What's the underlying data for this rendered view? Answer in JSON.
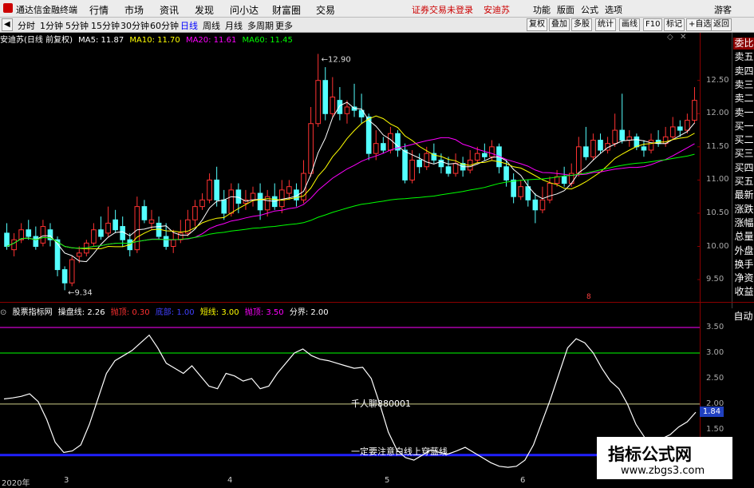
{
  "window": {
    "title": "通达信金融终端",
    "menus": [
      "行情",
      "市场",
      "资讯",
      "发现",
      "问小达",
      "财富圈",
      "交易"
    ],
    "login_notice": "证券交易未登录",
    "stock_name_top": "安迪苏",
    "right_menus": [
      "功能",
      "版面",
      "公式",
      "选项"
    ],
    "guest": "游客"
  },
  "toolbar": {
    "periods": [
      "分时",
      "1分钟",
      "5分钟",
      "15分钟",
      "30分钟",
      "60分钟",
      "日线",
      "周线",
      "月线",
      "多周期",
      "更多"
    ],
    "active_period": "日线",
    "buttons": [
      "复权",
      "叠加",
      "多股",
      "统计",
      "画线",
      "F10",
      "标记",
      "+自选",
      "返回"
    ]
  },
  "main_chart": {
    "title": "安迪苏(日线 前复权)",
    "ma_labels": [
      {
        "text": "MA5: 11.87",
        "color": "#ffffff"
      },
      {
        "text": "MA10: 11.70",
        "color": "#ffff00"
      },
      {
        "text": "MA20: 11.61",
        "color": "#ff00ff"
      },
      {
        "text": "MA60: 11.45",
        "color": "#00ff00"
      }
    ],
    "high_label": "12.90",
    "low_label": "9.34",
    "y_ticks": [
      "12.50",
      "12.00",
      "11.50",
      "11.00",
      "10.50",
      "10.00",
      "9.50"
    ],
    "marker": "8",
    "candles": [
      [
        10.2,
        10.0,
        10.35,
        9.95
      ],
      [
        9.95,
        10.1,
        10.2,
        9.85
      ],
      [
        10.1,
        10.25,
        10.35,
        10.05
      ],
      [
        10.25,
        10.15,
        10.4,
        10.1
      ],
      [
        10.15,
        10.0,
        10.3,
        9.95
      ],
      [
        10.05,
        10.3,
        10.4,
        10.0
      ],
      [
        10.25,
        10.1,
        10.35,
        10.0
      ],
      [
        10.1,
        9.65,
        10.15,
        9.55
      ],
      [
        9.65,
        9.45,
        9.7,
        9.34
      ],
      [
        9.45,
        9.8,
        9.85,
        9.4
      ],
      [
        9.85,
        9.9,
        10.0,
        9.75
      ],
      [
        9.9,
        10.05,
        10.1,
        9.85
      ],
      [
        10.05,
        10.25,
        10.35,
        10.0
      ],
      [
        10.25,
        10.15,
        10.45,
        10.1
      ],
      [
        10.2,
        10.35,
        10.6,
        10.15
      ],
      [
        10.4,
        10.25,
        10.55,
        10.2
      ],
      [
        10.3,
        10.1,
        10.45,
        10.0
      ],
      [
        10.1,
        9.95,
        10.2,
        9.85
      ],
      [
        9.95,
        10.6,
        10.75,
        9.9
      ],
      [
        10.6,
        10.4,
        10.7,
        10.35
      ],
      [
        10.35,
        10.4,
        10.55,
        10.25
      ],
      [
        10.35,
        10.15,
        10.45,
        10.1
      ],
      [
        10.15,
        10.0,
        10.35,
        9.95
      ],
      [
        10.0,
        10.1,
        10.25,
        9.9
      ],
      [
        10.1,
        10.2,
        10.4,
        10.05
      ],
      [
        10.2,
        10.4,
        10.55,
        10.15
      ],
      [
        10.4,
        10.6,
        10.7,
        10.3
      ],
      [
        10.6,
        10.7,
        10.8,
        10.55
      ],
      [
        10.7,
        11.0,
        11.1,
        10.65
      ],
      [
        11.0,
        10.7,
        11.2,
        10.6
      ],
      [
        10.7,
        10.5,
        10.85,
        10.4
      ],
      [
        10.5,
        10.85,
        10.95,
        10.45
      ],
      [
        10.85,
        10.65,
        10.95,
        10.5
      ],
      [
        10.65,
        10.7,
        10.85,
        10.55
      ],
      [
        10.7,
        10.8,
        10.9,
        10.6
      ],
      [
        10.8,
        10.55,
        10.95,
        10.4
      ],
      [
        10.55,
        10.75,
        10.85,
        10.45
      ],
      [
        10.75,
        10.6,
        10.95,
        10.55
      ],
      [
        10.6,
        10.85,
        11.0,
        10.5
      ],
      [
        10.8,
        10.9,
        11.0,
        10.7
      ],
      [
        10.85,
        10.7,
        10.95,
        10.6
      ],
      [
        10.7,
        11.1,
        11.3,
        10.65
      ],
      [
        11.1,
        11.85,
        12.1,
        11.05
      ],
      [
        11.85,
        12.5,
        12.9,
        11.8
      ],
      [
        12.5,
        12.0,
        12.7,
        11.9
      ],
      [
        12.0,
        12.25,
        12.55,
        11.95
      ],
      [
        12.2,
        12.0,
        12.4,
        11.9
      ],
      [
        12.0,
        12.1,
        12.2,
        11.85
      ],
      [
        12.1,
        12.05,
        12.45,
        11.95
      ],
      [
        12.05,
        11.95,
        12.3,
        11.85
      ],
      [
        11.95,
        11.4,
        12.0,
        11.3
      ],
      [
        11.4,
        11.55,
        11.75,
        11.3
      ],
      [
        11.55,
        11.45,
        11.65,
        11.4
      ],
      [
        11.45,
        11.7,
        11.8,
        11.4
      ],
      [
        11.7,
        11.45,
        11.75,
        11.35
      ],
      [
        11.45,
        11.0,
        11.55,
        10.95
      ],
      [
        11.0,
        11.3,
        11.45,
        10.95
      ],
      [
        11.3,
        11.2,
        11.4,
        11.1
      ],
      [
        11.2,
        11.4,
        11.5,
        11.15
      ],
      [
        11.4,
        11.3,
        11.55,
        11.25
      ],
      [
        11.3,
        11.2,
        11.4,
        11.1
      ],
      [
        11.2,
        11.1,
        11.35,
        11.05
      ],
      [
        11.1,
        11.25,
        11.4,
        11.05
      ],
      [
        11.25,
        11.15,
        11.35,
        11.05
      ],
      [
        11.15,
        11.3,
        11.45,
        11.1
      ],
      [
        11.3,
        11.4,
        11.5,
        11.25
      ],
      [
        11.4,
        11.35,
        11.55,
        11.3
      ],
      [
        11.35,
        11.5,
        11.6,
        11.3
      ],
      [
        11.5,
        11.2,
        11.55,
        11.1
      ],
      [
        11.2,
        11.0,
        11.3,
        10.9
      ],
      [
        11.0,
        10.75,
        11.1,
        10.65
      ],
      [
        10.75,
        10.9,
        11.0,
        10.7
      ],
      [
        10.9,
        10.7,
        11.0,
        10.6
      ],
      [
        10.7,
        10.55,
        10.8,
        10.35
      ],
      [
        10.55,
        10.7,
        10.9,
        10.5
      ],
      [
        10.7,
        10.95,
        11.05,
        10.65
      ],
      [
        10.95,
        11.05,
        11.15,
        10.9
      ],
      [
        11.05,
        10.95,
        11.2,
        10.9
      ],
      [
        10.95,
        11.1,
        11.25,
        10.9
      ],
      [
        11.1,
        11.5,
        11.65,
        11.05
      ],
      [
        11.5,
        11.35,
        11.8,
        11.3
      ],
      [
        11.35,
        11.6,
        11.7,
        11.3
      ],
      [
        11.6,
        11.45,
        11.7,
        11.4
      ],
      [
        11.45,
        11.55,
        11.65,
        11.4
      ],
      [
        11.55,
        11.75,
        12.0,
        11.5
      ],
      [
        11.75,
        11.6,
        12.3,
        11.55
      ],
      [
        11.6,
        11.65,
        11.75,
        11.5
      ],
      [
        11.65,
        11.5,
        11.7,
        11.45
      ],
      [
        11.5,
        11.45,
        11.6,
        11.35
      ],
      [
        11.45,
        11.6,
        11.7,
        11.4
      ],
      [
        11.6,
        11.55,
        11.75,
        11.5
      ],
      [
        11.55,
        11.65,
        11.8,
        11.5
      ],
      [
        11.65,
        11.8,
        11.95,
        11.6
      ],
      [
        11.8,
        11.75,
        11.9,
        11.65
      ],
      [
        11.75,
        11.9,
        12.0,
        11.7
      ],
      [
        11.9,
        12.2,
        12.4,
        11.85
      ]
    ]
  },
  "indicator": {
    "name": "股票指标网",
    "labels": [
      {
        "text": "操盘线: 2.26",
        "color": "#ffffff"
      },
      {
        "text": "抛顶: 0.30",
        "color": "#ff3030"
      },
      {
        "text": "底部: 1.00",
        "color": "#4040ff"
      },
      {
        "text": "短线: 3.00",
        "color": "#ffff00"
      },
      {
        "text": "抛顶: 3.50",
        "color": "#ff00ff"
      },
      {
        "text": "分界: 2.00",
        "color": "#ffffff"
      }
    ],
    "y_ticks": [
      "3.50",
      "3.00",
      "2.50",
      "2.00",
      "1.50",
      "1.00"
    ],
    "current_value": "1.84",
    "annotation1": "千人聊880001",
    "annotation2": "一定要注意白线上穿蓝线",
    "line_values": [
      2.1,
      2.12,
      2.15,
      2.2,
      2.05,
      1.7,
      1.25,
      1.05,
      1.08,
      1.2,
      1.6,
      2.1,
      2.6,
      2.85,
      2.95,
      3.05,
      3.2,
      3.35,
      3.1,
      2.8,
      2.7,
      2.6,
      2.75,
      2.55,
      2.35,
      2.3,
      2.6,
      2.55,
      2.45,
      2.5,
      2.3,
      2.35,
      2.6,
      2.8,
      3.0,
      3.08,
      2.95,
      2.88,
      2.85,
      2.8,
      2.75,
      2.7,
      2.72,
      2.5,
      2.0,
      1.45,
      1.1,
      0.95,
      0.9,
      1.0,
      1.1,
      1.05,
      1.02,
      1.08,
      1.15,
      1.05,
      0.95,
      0.85,
      0.78,
      0.76,
      0.78,
      0.9,
      1.2,
      1.65,
      2.1,
      2.6,
      3.1,
      3.28,
      3.2,
      3.0,
      2.7,
      2.45,
      2.3,
      2.0,
      1.6,
      1.35,
      1.3,
      1.32,
      1.4,
      1.55,
      1.65,
      1.84
    ]
  },
  "x_axis": [
    "2020年",
    "3",
    "4",
    "5",
    "6"
  ],
  "watermark": {
    "line1": "指标公式网",
    "line2": "www.zbgs3.com"
  }
}
